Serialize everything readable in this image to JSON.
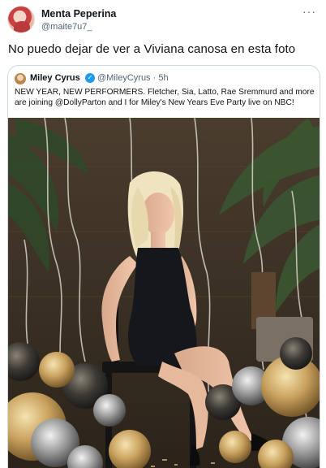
{
  "tweet": {
    "author_name": "Menta Peperina",
    "author_handle": "@maite7u7_",
    "more_label": "···",
    "text": "No puedo dejar de ver a Viviana canosa en esta foto"
  },
  "quoted": {
    "author_name": "Miley Cyrus",
    "author_handle": "@MileyCyrus",
    "separator": "·",
    "time": "5h",
    "text": "NEW YEAR, NEW PERFORMERS. Fletcher, Sia, Latto, Rae Sremmurd and more are joining @DollyParton and I for Miley's New Years Eve Party live on NBC!",
    "image_icon": "photo-image",
    "verified_icon": "verified-badge-icon"
  },
  "colors": {
    "text_primary": "#0f1419",
    "text_secondary": "#536471",
    "border": "#cfd9de",
    "verified": "#1d9bf0"
  }
}
